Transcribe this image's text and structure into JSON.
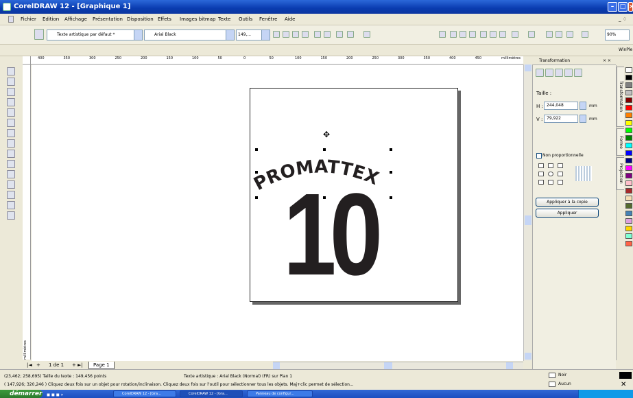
{
  "window": {
    "title": "CorelDRAW 12 - [Graphique 1]"
  },
  "menu": [
    "Fichier",
    "Edition",
    "Affichage",
    "Présentation",
    "Disposition",
    "Effets",
    "Images bitmap",
    "Texte",
    "Outils",
    "Fenêtre",
    "Aide"
  ],
  "propbar": {
    "style_combo": "Texte artistique par défaut *",
    "font_combo": "Arial Black",
    "size_combo": "149,..."
  },
  "zoom": "90%",
  "wingdings_label": "WinPle",
  "ruler": {
    "h_ticks": [
      "400",
      "350",
      "300",
      "250",
      "200",
      "150",
      "100",
      "50",
      "0",
      "50",
      "100",
      "150",
      "200",
      "250",
      "300",
      "350",
      "400",
      "450"
    ],
    "unit": "millimètres",
    "v_unit": "millimètres"
  },
  "artwork": {
    "arc_text": "PROMATTEX",
    "number": "10"
  },
  "page_nav": {
    "counter": "1 de 1",
    "tab": "Page 1"
  },
  "docker": {
    "title": "Transformation",
    "size_label": "Taille :",
    "h_label": "H :",
    "h_value": "244,048",
    "v_label": "V :",
    "v_value": "79,922",
    "unit_h": "mm",
    "unit_v": "mm",
    "non_prop_label": "Non proportionnelle",
    "apply_copy": "Appliquer à la copie",
    "apply": "Appliquer"
  },
  "vtabs": [
    "Transformation",
    "Forme",
    "Projection"
  ],
  "palette_colors": [
    "#ffffff",
    "#000000",
    "#808080",
    "#c0c0c0",
    "#800000",
    "#ff0000",
    "#ff8000",
    "#ffff00",
    "#00ff00",
    "#008000",
    "#00ffff",
    "#0000ff",
    "#000080",
    "#ff00ff",
    "#800080",
    "#ffc0cb",
    "#a52a2a",
    "#f5deb3",
    "#556b2f",
    "#4682b4",
    "#dda0dd",
    "#ffd700",
    "#7fffd4",
    "#ff6347"
  ],
  "status": {
    "line1_left": "(23,462; 258,695)  Taille du texte : 149,456 points",
    "line1_mid": "Texte artistique : Arial Black (Normal) (FR) sur Plan 1",
    "line2": "( 147,926; 320,246 )    Cliquez deux fois sur un objet pour rotation/inclinaison. Cliquez deux fois sur l'outil pour sélectionner tous les objets. Maj+clic permet de sélection...",
    "fill": "Noir",
    "outline": "Aucun"
  },
  "taskbar": {
    "start": "démarrer",
    "tasks": [
      "CorelDRAW 12 - [Gra...",
      "CorelDRAW 12 - [Gra...",
      "Panneau de configur..."
    ]
  }
}
